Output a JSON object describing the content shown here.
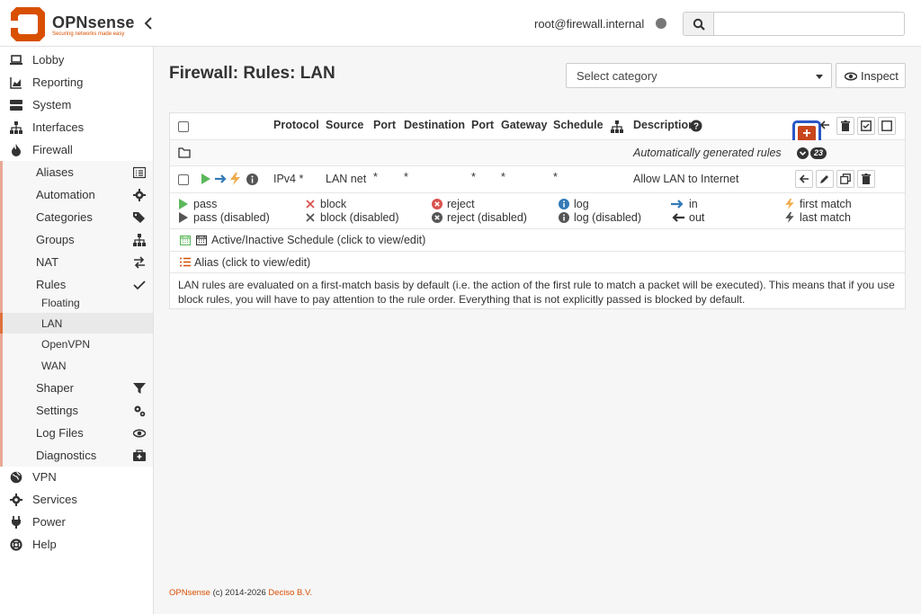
{
  "brand": {
    "name": "OPNsense",
    "tagline": "Securing networks made easy"
  },
  "header": {
    "user": "root@firewall.internal",
    "search": {
      "value": "",
      "placeholder": ""
    }
  },
  "sidebar": {
    "items": [
      {
        "label": "Lobby",
        "icon": "laptop-icon"
      },
      {
        "label": "Reporting",
        "icon": "area-chart-icon"
      },
      {
        "label": "System",
        "icon": "server-icon"
      },
      {
        "label": "Interfaces",
        "icon": "sitemap-icon"
      },
      {
        "label": "Firewall",
        "icon": "fire-icon"
      },
      {
        "label": "VPN",
        "icon": "globe-icon"
      },
      {
        "label": "Services",
        "icon": "cog-icon"
      },
      {
        "label": "Power",
        "icon": "plug-icon"
      },
      {
        "label": "Help",
        "icon": "life-ring-icon"
      }
    ],
    "firewall_sub": [
      {
        "label": "Aliases",
        "icon": "list-alt-icon"
      },
      {
        "label": "Automation",
        "icon": "cog-icon"
      },
      {
        "label": "Categories",
        "icon": "tags-icon"
      },
      {
        "label": "Groups",
        "icon": "sitemap-icon"
      },
      {
        "label": "NAT",
        "icon": "exchange-icon"
      },
      {
        "label": "Rules",
        "icon": "check-icon"
      },
      {
        "label": "Shaper",
        "icon": "filter-icon"
      },
      {
        "label": "Settings",
        "icon": "cogs-icon"
      },
      {
        "label": "Log Files",
        "icon": "eye-icon"
      },
      {
        "label": "Diagnostics",
        "icon": "medkit-icon"
      }
    ],
    "rules_sub": [
      "Floating",
      "LAN",
      "OpenVPN",
      "WAN"
    ],
    "active": "LAN"
  },
  "page": {
    "title": "Firewall: Rules: LAN",
    "category_select": {
      "value": "Select category"
    },
    "inspect_label": "Inspect"
  },
  "table": {
    "headers": {
      "protocol": "Protocol",
      "source": "Source",
      "port": "Port",
      "destination": "Destination",
      "port2": "Port",
      "gateway": "Gateway",
      "schedule": "Schedule",
      "description": "Description"
    },
    "auto_rules": {
      "label": "Automatically generated rules",
      "count": "23"
    },
    "rows": [
      {
        "protocol": "IPv4 *",
        "source": "LAN net",
        "port": "*",
        "destination": "*",
        "port2": "*",
        "gateway": "*",
        "schedule": "*",
        "description": "Allow LAN to Internet"
      }
    ]
  },
  "legend": {
    "pass": "pass",
    "pass_disabled": "pass (disabled)",
    "block": "block",
    "block_disabled": "block (disabled)",
    "reject": "reject",
    "reject_disabled": "reject (disabled)",
    "log": "log",
    "log_disabled": "log (disabled)",
    "in": "in",
    "out": "out",
    "first_match": "first match",
    "last_match": "last match",
    "schedule": "Active/Inactive Schedule (click to view/edit)",
    "alias": "Alias (click to view/edit)",
    "note": "LAN rules are evaluated on a first-match basis by default (i.e. the action of the first rule to match a packet will be executed). This means that if you use block rules, you will have to pay attention to the rule order. Everything that is not explicitly passed is blocked by default."
  },
  "footer": {
    "product": "OPNsense",
    "copy": "(c) 2014-2026",
    "company": "Deciso B.V."
  },
  "colors": {
    "accent": "#d94f00",
    "add_button": "#c8461d",
    "highlight_border": "#2a56c6",
    "pass": "#5cb85c"
  }
}
